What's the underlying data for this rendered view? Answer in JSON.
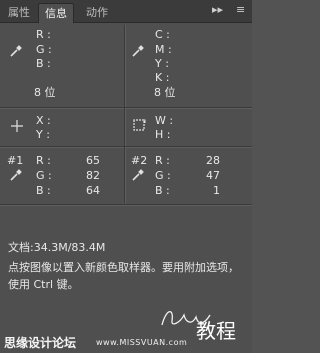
{
  "tabs": [
    {
      "label": "属性",
      "active": false
    },
    {
      "label": "信息",
      "active": true
    },
    {
      "label": "动作",
      "active": false
    }
  ],
  "tab_controls": {
    "collapse": "▸▸",
    "menu": "≡"
  },
  "color1": {
    "labels": [
      "R :",
      "G :",
      "B :"
    ],
    "depth": "8 位"
  },
  "color2": {
    "labels": [
      "C :",
      "M :",
      "Y :",
      "K :"
    ],
    "depth": "8 位"
  },
  "position": {
    "labels": [
      "X :",
      "Y :"
    ]
  },
  "size": {
    "labels": [
      "W :",
      "H :"
    ]
  },
  "sampler1": {
    "id": "#1",
    "rows": [
      {
        "label": "R :",
        "value": "65"
      },
      {
        "label": "G :",
        "value": "82"
      },
      {
        "label": "B :",
        "value": "64"
      }
    ]
  },
  "sampler2": {
    "id": "#2",
    "rows": [
      {
        "label": "R :",
        "value": "28"
      },
      {
        "label": "G :",
        "value": "47"
      },
      {
        "label": "B :",
        "value": "1"
      }
    ]
  },
  "status": "文档:34.3M/83.4M",
  "hint": "点按图像以置入新颜色取样器。要用附加选项，使用 Ctrl 键。",
  "watermark": {
    "left": "思缘设计论坛",
    "url": "www.MISSVUAN.com",
    "script": "Lanyue",
    "big": "教程"
  },
  "icons": {
    "eyedropper": "eyedropper-icon",
    "crosshair": "crosshair-icon",
    "selection": "selection-size-icon"
  }
}
